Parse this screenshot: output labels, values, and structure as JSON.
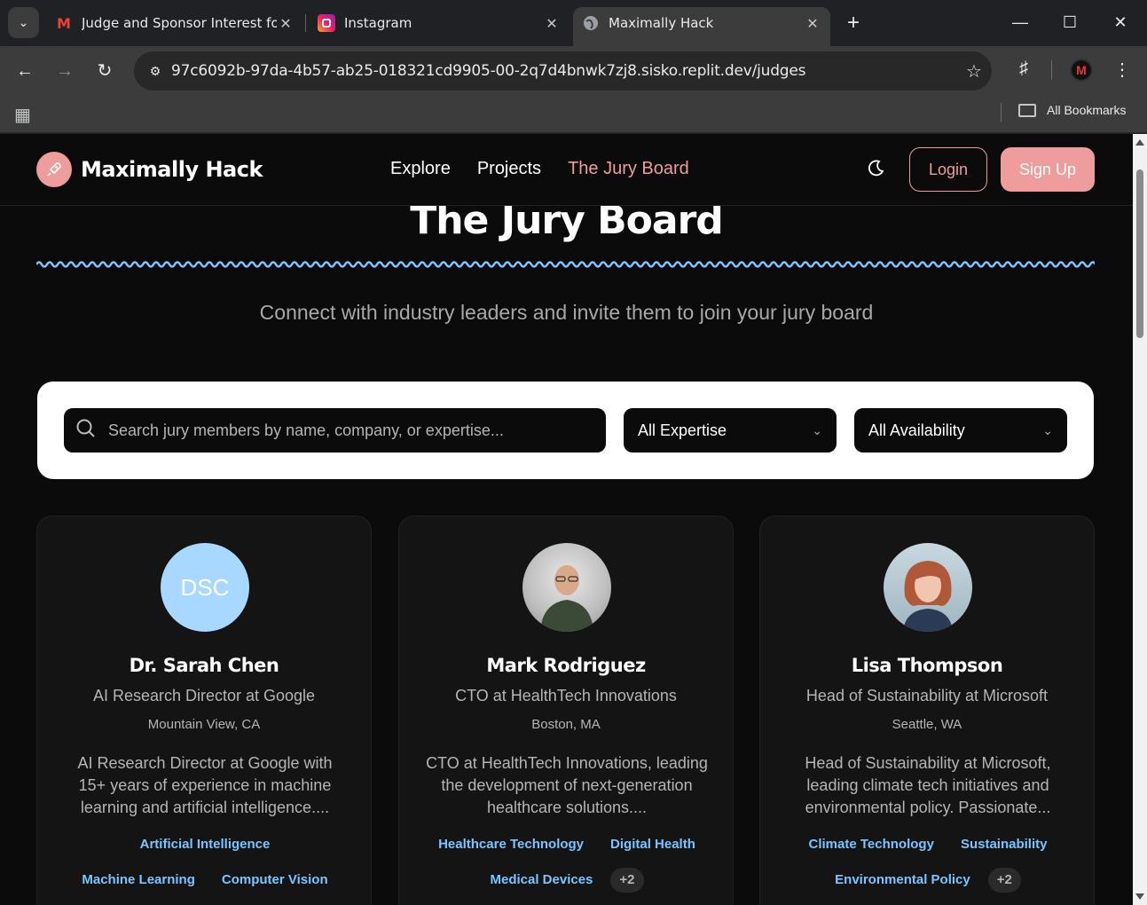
{
  "browser": {
    "tabs": [
      {
        "title": "Judge and Sponsor Interest for",
        "favicon": "gmail-icon"
      },
      {
        "title": "Instagram",
        "favicon": "instagram-icon"
      },
      {
        "title": "Maximally Hack",
        "favicon": "globe-icon",
        "active": true
      }
    ],
    "url": "97c6092b-97da-4b57-ab25-018321cd9905-00-2q7d4bnwk7zj8.sisko.replit.dev/judges",
    "bookmarks_label": "All Bookmarks",
    "profile_initial": "M"
  },
  "site": {
    "brand": "Maximally Hack",
    "nav": [
      "Explore",
      "Projects",
      "The Jury Board"
    ],
    "active_nav": "The Jury Board",
    "login": "Login",
    "signup": "Sign Up",
    "accent": "#ee9c9c"
  },
  "hero": {
    "title": "The Jury Board",
    "subtitle": "Connect with industry leaders and invite them to join your jury board"
  },
  "filters": {
    "search_placeholder": "Search jury members by name, company, or expertise...",
    "expertise": "All Expertise",
    "availability": "All Availability"
  },
  "judges": [
    {
      "initials": "DSC",
      "name": "Dr. Sarah Chen",
      "role": "AI Research Director at Google",
      "location": "Mountain View, CA",
      "bio": "AI Research Director at Google with 15+ years of experience in machine learning and artificial intelligence....",
      "tags": [
        "Artificial Intelligence",
        "Machine Learning",
        "Computer Vision"
      ],
      "more": ""
    },
    {
      "initials": "",
      "name": "Mark Rodriguez",
      "role": "CTO at HealthTech Innovations",
      "location": "Boston, MA",
      "bio": "CTO at HealthTech Innovations, leading the development of next-generation healthcare solutions....",
      "tags": [
        "Healthcare Technology",
        "Digital Health",
        "Medical Devices"
      ],
      "more": "+2"
    },
    {
      "initials": "",
      "name": "Lisa Thompson",
      "role": "Head of Sustainability at Microsoft",
      "location": "Seattle, WA",
      "bio": "Head of Sustainability at Microsoft, leading climate tech initiatives and environmental policy. Passionate...",
      "tags": [
        "Climate Technology",
        "Sustainability",
        "Environmental Policy"
      ],
      "more": "+2"
    }
  ]
}
